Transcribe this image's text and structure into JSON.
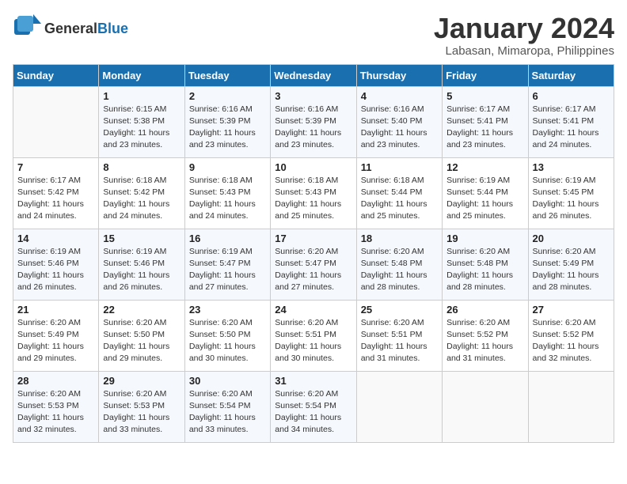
{
  "logo": {
    "text_general": "General",
    "text_blue": "Blue"
  },
  "title": "January 2024",
  "subtitle": "Labasan, Mimaropa, Philippines",
  "days_header": [
    "Sunday",
    "Monday",
    "Tuesday",
    "Wednesday",
    "Thursday",
    "Friday",
    "Saturday"
  ],
  "weeks": [
    [
      {
        "day": "",
        "info": ""
      },
      {
        "day": "1",
        "info": "Sunrise: 6:15 AM\nSunset: 5:38 PM\nDaylight: 11 hours\nand 23 minutes."
      },
      {
        "day": "2",
        "info": "Sunrise: 6:16 AM\nSunset: 5:39 PM\nDaylight: 11 hours\nand 23 minutes."
      },
      {
        "day": "3",
        "info": "Sunrise: 6:16 AM\nSunset: 5:39 PM\nDaylight: 11 hours\nand 23 minutes."
      },
      {
        "day": "4",
        "info": "Sunrise: 6:16 AM\nSunset: 5:40 PM\nDaylight: 11 hours\nand 23 minutes."
      },
      {
        "day": "5",
        "info": "Sunrise: 6:17 AM\nSunset: 5:41 PM\nDaylight: 11 hours\nand 23 minutes."
      },
      {
        "day": "6",
        "info": "Sunrise: 6:17 AM\nSunset: 5:41 PM\nDaylight: 11 hours\nand 24 minutes."
      }
    ],
    [
      {
        "day": "7",
        "info": "Sunrise: 6:17 AM\nSunset: 5:42 PM\nDaylight: 11 hours\nand 24 minutes."
      },
      {
        "day": "8",
        "info": "Sunrise: 6:18 AM\nSunset: 5:42 PM\nDaylight: 11 hours\nand 24 minutes."
      },
      {
        "day": "9",
        "info": "Sunrise: 6:18 AM\nSunset: 5:43 PM\nDaylight: 11 hours\nand 24 minutes."
      },
      {
        "day": "10",
        "info": "Sunrise: 6:18 AM\nSunset: 5:43 PM\nDaylight: 11 hours\nand 25 minutes."
      },
      {
        "day": "11",
        "info": "Sunrise: 6:18 AM\nSunset: 5:44 PM\nDaylight: 11 hours\nand 25 minutes."
      },
      {
        "day": "12",
        "info": "Sunrise: 6:19 AM\nSunset: 5:44 PM\nDaylight: 11 hours\nand 25 minutes."
      },
      {
        "day": "13",
        "info": "Sunrise: 6:19 AM\nSunset: 5:45 PM\nDaylight: 11 hours\nand 26 minutes."
      }
    ],
    [
      {
        "day": "14",
        "info": "Sunrise: 6:19 AM\nSunset: 5:46 PM\nDaylight: 11 hours\nand 26 minutes."
      },
      {
        "day": "15",
        "info": "Sunrise: 6:19 AM\nSunset: 5:46 PM\nDaylight: 11 hours\nand 26 minutes."
      },
      {
        "day": "16",
        "info": "Sunrise: 6:19 AM\nSunset: 5:47 PM\nDaylight: 11 hours\nand 27 minutes."
      },
      {
        "day": "17",
        "info": "Sunrise: 6:20 AM\nSunset: 5:47 PM\nDaylight: 11 hours\nand 27 minutes."
      },
      {
        "day": "18",
        "info": "Sunrise: 6:20 AM\nSunset: 5:48 PM\nDaylight: 11 hours\nand 28 minutes."
      },
      {
        "day": "19",
        "info": "Sunrise: 6:20 AM\nSunset: 5:48 PM\nDaylight: 11 hours\nand 28 minutes."
      },
      {
        "day": "20",
        "info": "Sunrise: 6:20 AM\nSunset: 5:49 PM\nDaylight: 11 hours\nand 28 minutes."
      }
    ],
    [
      {
        "day": "21",
        "info": "Sunrise: 6:20 AM\nSunset: 5:49 PM\nDaylight: 11 hours\nand 29 minutes."
      },
      {
        "day": "22",
        "info": "Sunrise: 6:20 AM\nSunset: 5:50 PM\nDaylight: 11 hours\nand 29 minutes."
      },
      {
        "day": "23",
        "info": "Sunrise: 6:20 AM\nSunset: 5:50 PM\nDaylight: 11 hours\nand 30 minutes."
      },
      {
        "day": "24",
        "info": "Sunrise: 6:20 AM\nSunset: 5:51 PM\nDaylight: 11 hours\nand 30 minutes."
      },
      {
        "day": "25",
        "info": "Sunrise: 6:20 AM\nSunset: 5:51 PM\nDaylight: 11 hours\nand 31 minutes."
      },
      {
        "day": "26",
        "info": "Sunrise: 6:20 AM\nSunset: 5:52 PM\nDaylight: 11 hours\nand 31 minutes."
      },
      {
        "day": "27",
        "info": "Sunrise: 6:20 AM\nSunset: 5:52 PM\nDaylight: 11 hours\nand 32 minutes."
      }
    ],
    [
      {
        "day": "28",
        "info": "Sunrise: 6:20 AM\nSunset: 5:53 PM\nDaylight: 11 hours\nand 32 minutes."
      },
      {
        "day": "29",
        "info": "Sunrise: 6:20 AM\nSunset: 5:53 PM\nDaylight: 11 hours\nand 33 minutes."
      },
      {
        "day": "30",
        "info": "Sunrise: 6:20 AM\nSunset: 5:54 PM\nDaylight: 11 hours\nand 33 minutes."
      },
      {
        "day": "31",
        "info": "Sunrise: 6:20 AM\nSunset: 5:54 PM\nDaylight: 11 hours\nand 34 minutes."
      },
      {
        "day": "",
        "info": ""
      },
      {
        "day": "",
        "info": ""
      },
      {
        "day": "",
        "info": ""
      }
    ]
  ]
}
